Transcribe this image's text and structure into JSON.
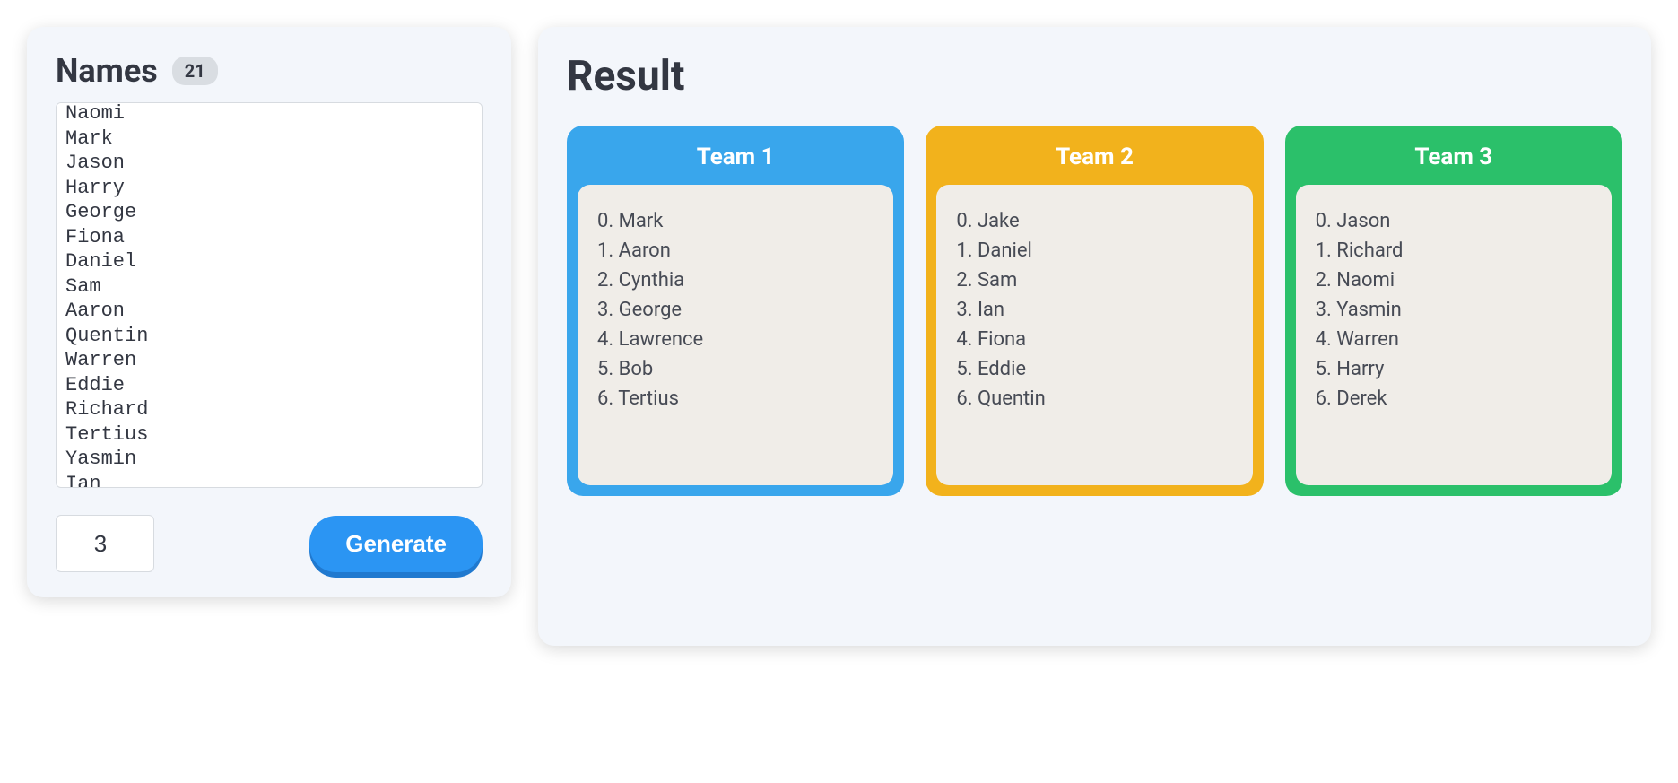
{
  "left": {
    "title": "Names",
    "count": "21",
    "textarea_value": "Naomi\nMark\nJason\nHarry\nGeorge\nFiona\nDaniel\nSam\nAaron\nQuentin\nWarren\nEddie\nRichard\nTertius\nYasmin\nIan",
    "team_count": "3",
    "generate_label": "Generate"
  },
  "result": {
    "title": "Result",
    "teams": [
      {
        "name": "Team 1",
        "color": "blue",
        "members": [
          "Mark",
          "Aaron",
          "Cynthia",
          "George",
          "Lawrence",
          "Bob",
          "Tertius"
        ]
      },
      {
        "name": "Team 2",
        "color": "orange",
        "members": [
          "Jake",
          "Daniel",
          "Sam",
          "Ian",
          "Fiona",
          "Eddie",
          "Quentin"
        ]
      },
      {
        "name": "Team 3",
        "color": "green",
        "members": [
          "Jason",
          "Richard",
          "Naomi",
          "Yasmin",
          "Warren",
          "Harry",
          "Derek"
        ]
      }
    ]
  }
}
